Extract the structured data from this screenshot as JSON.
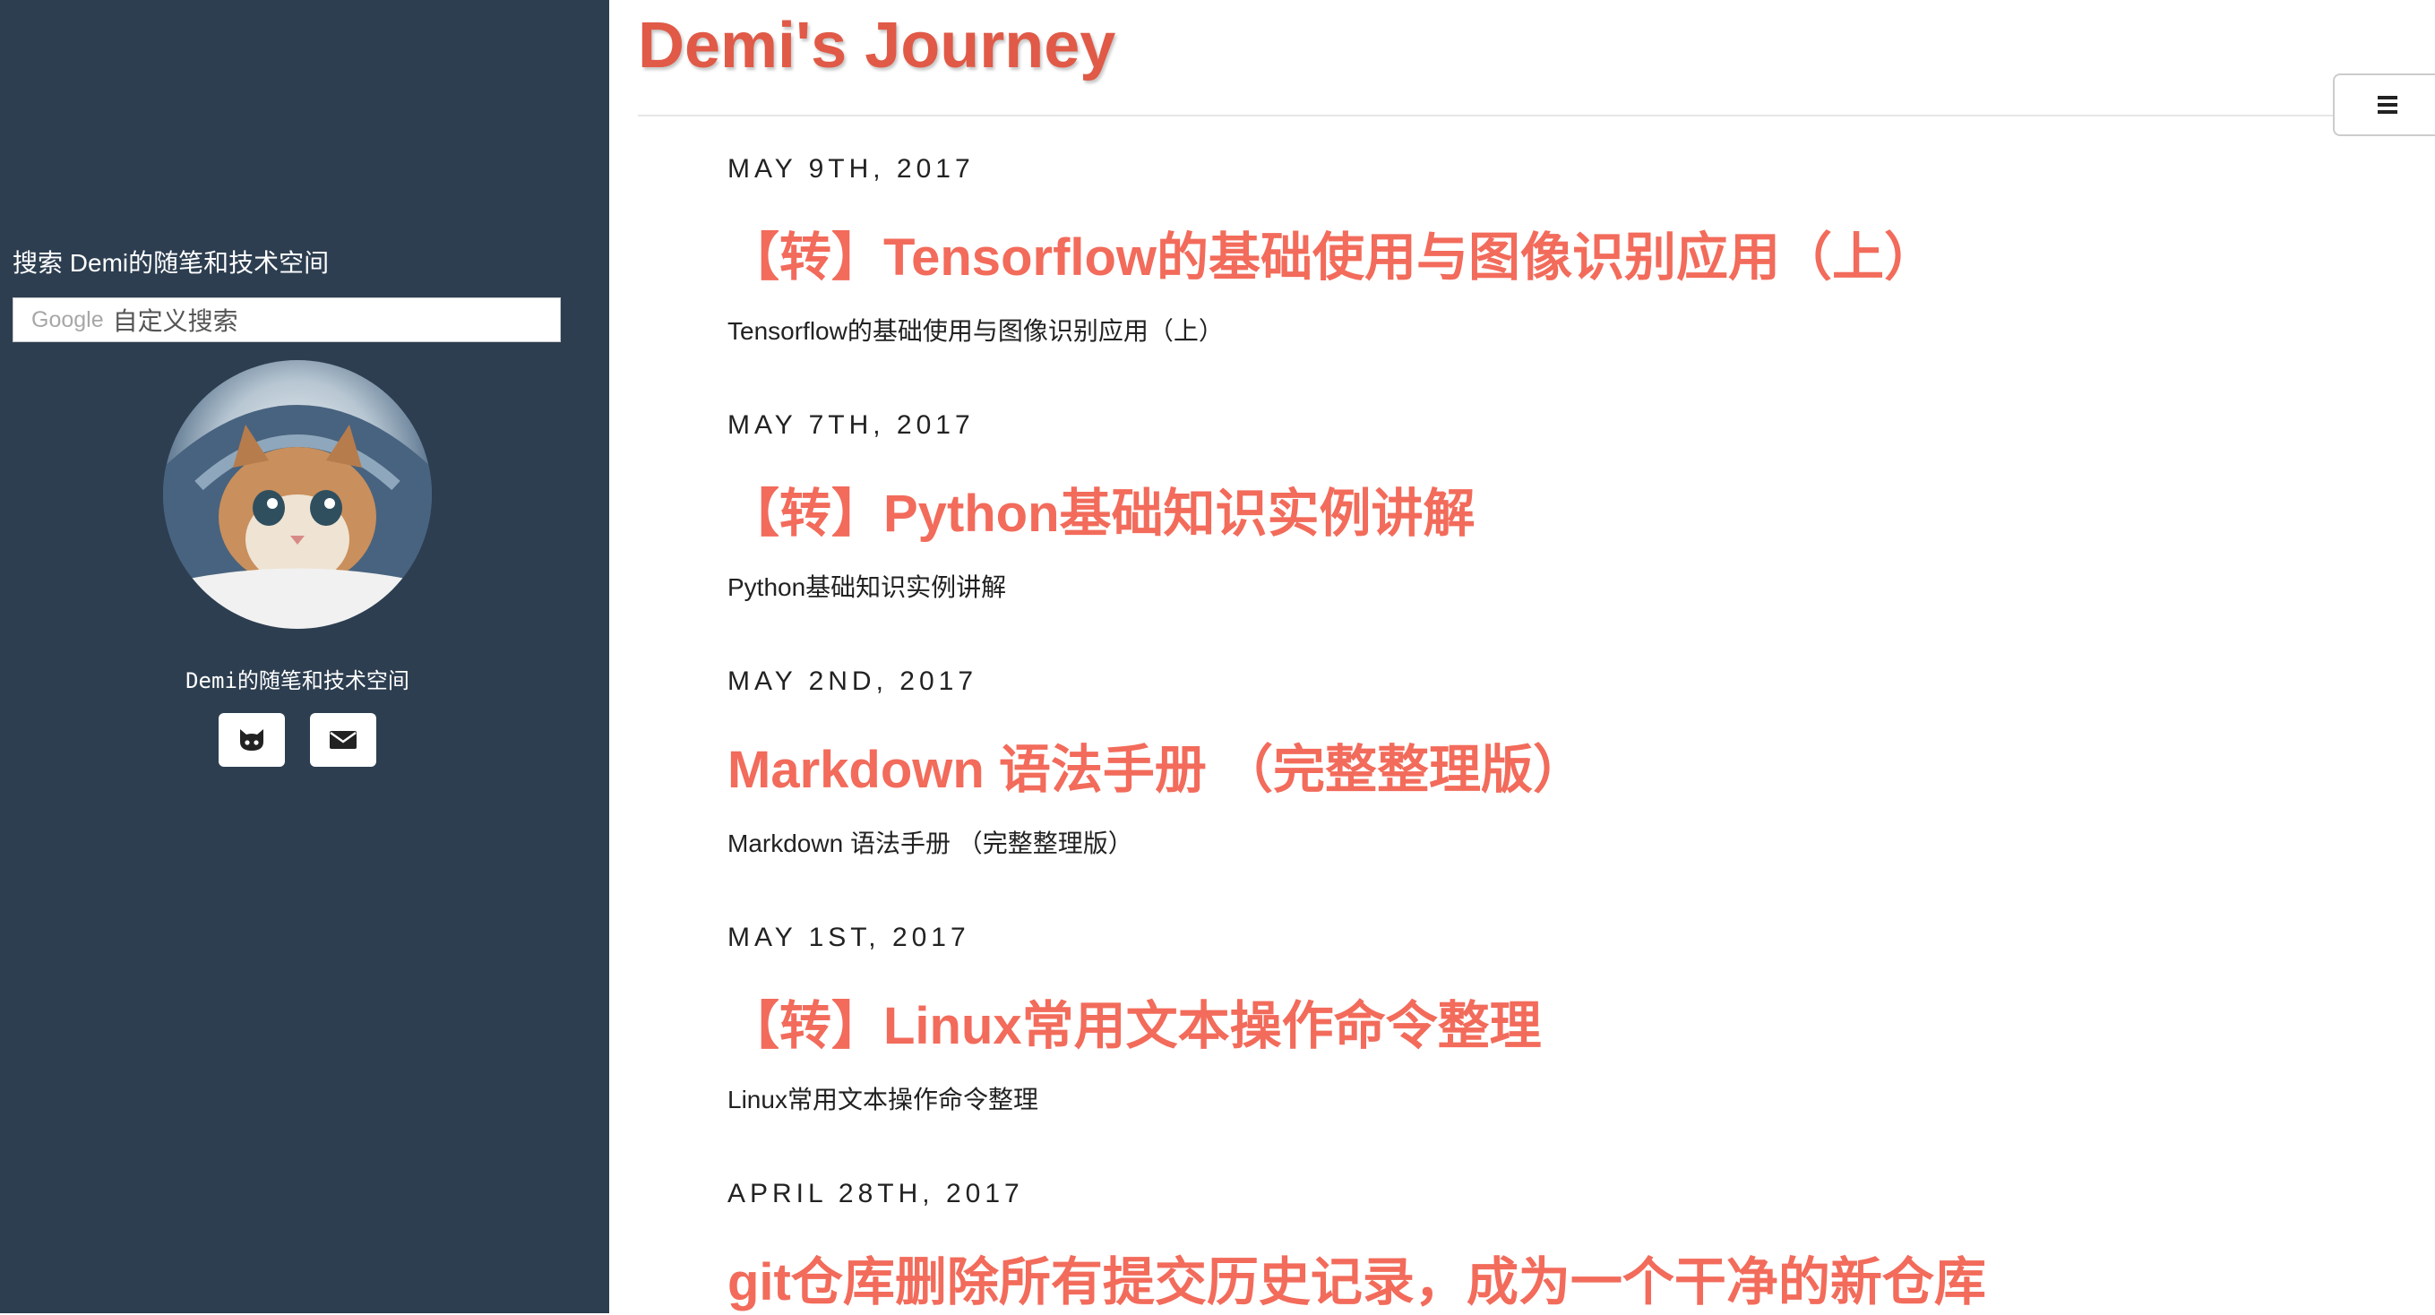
{
  "sidebar": {
    "search_label": "搜索 Demi的随笔和技术空间",
    "search_brand": "Google",
    "search_placeholder": "自定义搜索",
    "avatar_icon": "kitten-avatar",
    "tagline": "Demi的随笔和技术空间",
    "social": [
      {
        "icon": "github-icon"
      },
      {
        "icon": "mail-icon"
      }
    ]
  },
  "header": {
    "site_title": "Demi's Journey",
    "menu_icon": "hamburger-menu-icon"
  },
  "posts": [
    {
      "date": "May 9th, 2017",
      "title": "【转】Tensorflow的基础使用与图像识别应用（上）",
      "excerpt": "Tensorflow的基础使用与图像识别应用（上）"
    },
    {
      "date": "May 7th, 2017",
      "title": "【转】Python基础知识实例讲解",
      "excerpt": "Python基础知识实例讲解"
    },
    {
      "date": "May 2nd, 2017",
      "title": "Markdown 语法手册 （完整整理版）",
      "excerpt": "Markdown 语法手册 （完整整理版）"
    },
    {
      "date": "May 1st, 2017",
      "title": "【转】Linux常用文本操作命令整理",
      "excerpt": "Linux常用文本操作命令整理"
    },
    {
      "date": "April 28th, 2017",
      "title": "git仓库删除所有提交历史记录，成为一个干净的新仓库",
      "excerpt": ""
    }
  ],
  "colors": {
    "sidebar_bg": "#2d3e50",
    "accent": "#f26b5b",
    "title": "#e05a47"
  }
}
